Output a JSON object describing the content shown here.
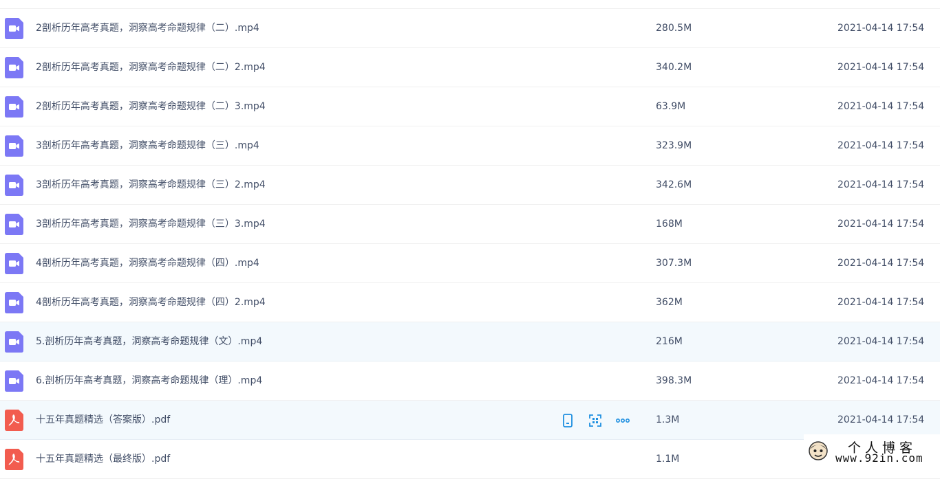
{
  "colors": {
    "video_icon": "#7c78f5",
    "pdf_icon": "#f25c4f",
    "action_icon": "#1e8fe0",
    "row_highlight": "#f3f9fd",
    "text": "#424e67"
  },
  "files": [
    {
      "type": "video",
      "icon": "video-file-icon",
      "name": "",
      "size": "",
      "date": "",
      "highlight": false
    },
    {
      "type": "video",
      "icon": "video-file-icon",
      "name": "2剖析历年高考真题，洞察高考命题规律（二）.mp4",
      "size": "280.5M",
      "date": "2021-04-14 17:54",
      "highlight": false
    },
    {
      "type": "video",
      "icon": "video-file-icon",
      "name": "2剖析历年高考真题，洞察高考命题规律（二）2.mp4",
      "size": "340.2M",
      "date": "2021-04-14 17:54",
      "highlight": false
    },
    {
      "type": "video",
      "icon": "video-file-icon",
      "name": "2剖析历年高考真题，洞察高考命题规律（二）3.mp4",
      "size": "63.9M",
      "date": "2021-04-14 17:54",
      "highlight": false
    },
    {
      "type": "video",
      "icon": "video-file-icon",
      "name": "3剖析历年高考真题，洞察高考命题规律（三）.mp4",
      "size": "323.9M",
      "date": "2021-04-14 17:54",
      "highlight": false
    },
    {
      "type": "video",
      "icon": "video-file-icon",
      "name": "3剖析历年高考真题，洞察高考命题规律（三）2.mp4",
      "size": "342.6M",
      "date": "2021-04-14 17:54",
      "highlight": false
    },
    {
      "type": "video",
      "icon": "video-file-icon",
      "name": "3剖析历年高考真题，洞察高考命题规律（三）3.mp4",
      "size": "168M",
      "date": "2021-04-14 17:54",
      "highlight": false
    },
    {
      "type": "video",
      "icon": "video-file-icon",
      "name": "4剖析历年高考真题，洞察高考命题规律（四）.mp4",
      "size": "307.3M",
      "date": "2021-04-14 17:54",
      "highlight": false
    },
    {
      "type": "video",
      "icon": "video-file-icon",
      "name": "4剖析历年高考真题，洞察高考命题规律（四）2.mp4",
      "size": "362M",
      "date": "2021-04-14 17:54",
      "highlight": false
    },
    {
      "type": "video",
      "icon": "video-file-icon",
      "name": "5.剖析历年高考真题，洞察高考命题规律（文）.mp4",
      "size": "216M",
      "date": "2021-04-14 17:54",
      "highlight": true
    },
    {
      "type": "video",
      "icon": "video-file-icon",
      "name": "6.剖析历年高考真题，洞察高考命题规律（理）.mp4",
      "size": "398.3M",
      "date": "2021-04-14 17:54",
      "highlight": false
    },
    {
      "type": "pdf",
      "icon": "pdf-file-icon",
      "name": "十五年真题精选（答案版）.pdf",
      "size": "1.3M",
      "date": "2021-04-14 17:54",
      "highlight": true,
      "hover_actions": [
        "phone-icon",
        "qr-scan-icon",
        "more-icon"
      ]
    },
    {
      "type": "pdf",
      "icon": "pdf-file-icon",
      "name": "十五年真题精选（最终版）.pdf",
      "size": "1.1M",
      "date": "",
      "highlight": false
    }
  ],
  "watermark": {
    "title": "个人博客",
    "url": "www.92in.com"
  }
}
